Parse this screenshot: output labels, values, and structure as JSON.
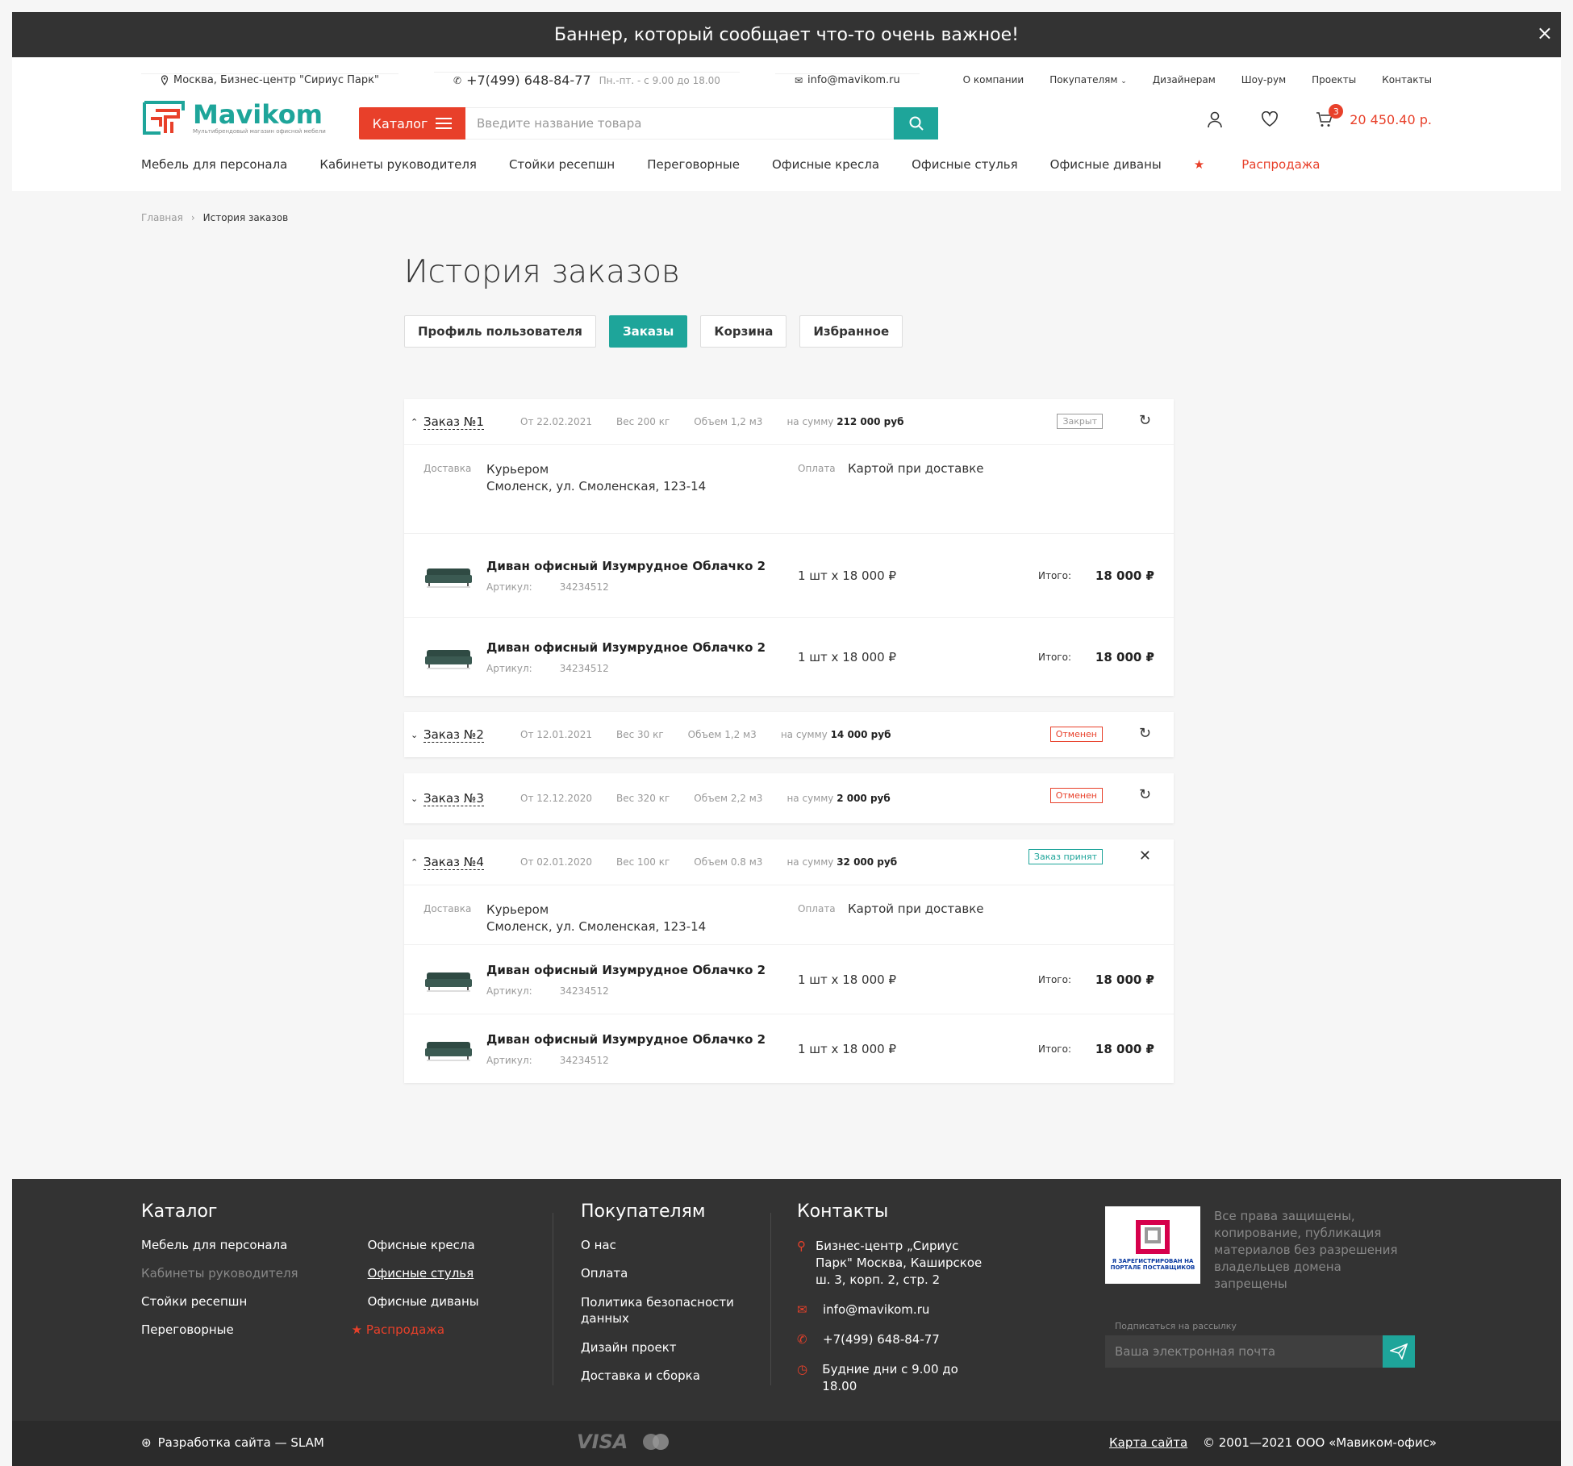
{
  "banner": {
    "text": "Баннер, который сообщает что-то очень важное!",
    "close": "×"
  },
  "topbar": {
    "address": "Москва, Бизнес-центр \"Сириус Парк\"",
    "phone": "+7(499) 648-84-77",
    "hours": "Пн.-пт. - с 9.00 до 18.00",
    "email": "info@mavikom.ru",
    "nav": [
      "О компании",
      "Покупателям",
      "Дизайнерам",
      "Шоу-рум",
      "Проекты",
      "Контакты"
    ]
  },
  "logo": {
    "name": "Mavikom",
    "sub": "Мультибрендовый магазин офисной мебели"
  },
  "search": {
    "catalog": "Каталог",
    "placeholder": "Введите название товара"
  },
  "cart": {
    "count": "3",
    "total": "20 450.40 р."
  },
  "mainnav": [
    "Мебель для персонала",
    "Кабинеты руководителя",
    "Стойки ресепшн",
    "Переговорные",
    "Офисные кресла",
    "Офисные стулья",
    "Офисные диваны"
  ],
  "sale": "Распродажа",
  "breadcrumbs": {
    "home": "Главная",
    "current": "История заказов"
  },
  "page_title": "История заказов",
  "tabs": [
    "Профиль пользователя",
    "Заказы",
    "Корзина",
    "Избранное"
  ],
  "labels": {
    "delivery": "Доставка",
    "payment": "Оплата",
    "article": "Артикул:",
    "total": "Итого:"
  },
  "orders": [
    {
      "title": "Заказ №1",
      "date": "От 22.02.2021",
      "weight": "Вес 200 кг",
      "volume": "Объем 1,2 м3",
      "sum_label": "на сумму",
      "sum": "212 000 руб",
      "status": "Закрыт",
      "delivery": "Курьером",
      "address": "Смоленск, ул. Смоленская, 123-14",
      "payment": "Картой при доставке",
      "items": [
        {
          "name": "Диван офисный Изумрудное Облачко 2",
          "article": "34234512",
          "qty": "1 шт х 18 000 ₽",
          "price": "18 000 ₽"
        },
        {
          "name": "Диван офисный Изумрудное Облачко 2",
          "article": "34234512",
          "qty": "1 шт х 18 000 ₽",
          "price": "18 000 ₽"
        }
      ]
    },
    {
      "title": "Заказ №2",
      "date": "От 12.01.2021",
      "weight": "Вес 30 кг",
      "volume": "Объем 1,2 м3",
      "sum_label": "на сумму",
      "sum": "14 000 руб",
      "status": "Отменен"
    },
    {
      "title": "Заказ №3",
      "date": "От 12.12.2020",
      "weight": "Вес 320 кг",
      "volume": "Объем 2,2 м3",
      "sum_label": "на сумму",
      "sum": "2 000 руб",
      "status": "Отменен"
    },
    {
      "title": "Заказ №4",
      "date": "От 02.01.2020",
      "weight": "Вес 100 кг",
      "volume": "Объем 0.8 м3",
      "sum_label": "на сумму",
      "sum": "32 000 руб",
      "status": "Заказ принят",
      "delivery": "Курьером",
      "address": "Смоленск, ул. Смоленская, 123-14",
      "payment": "Картой при доставке",
      "items": [
        {
          "name": "Диван офисный Изумрудное Облачко 2",
          "article": "34234512",
          "qty": "1 шт х 18 000 ₽",
          "price": "18 000 ₽"
        },
        {
          "name": "Диван офисный Изумрудное Облачко 2",
          "article": "34234512",
          "qty": "1 шт х 18 000 ₽",
          "price": "18 000 ₽"
        }
      ]
    }
  ],
  "footer": {
    "catalog_title": "Каталог",
    "catalog_col1": [
      "Мебель для персонала",
      "Кабинеты руководителя",
      "Стойки ресепшн",
      "Переговорные"
    ],
    "catalog_col2": [
      "Офисные кресла",
      "Офисные стулья",
      "Офисные диваны"
    ],
    "buyers_title": "Покупателям",
    "buyers": [
      "О нас",
      "Оплата",
      "Политика безопасности данных",
      "Дизайн проект",
      "Доставка и сборка"
    ],
    "contacts_title": "Контакты",
    "contact_address": "Бизнес-центр „Сириус Парк\" Москва, Каширское ш. 3, корп. 2, стр. 2",
    "contact_email": "info@mavikom.ru",
    "contact_phone": "+7(499) 648-84-77",
    "contact_hours": "Будние дни с 9.00 до 18.00",
    "seal_text": "Я ЗАРЕГИСТРИРОВАН НА ПОРТАЛЕ ПОСТАВЩИКОВ",
    "rights": "Все права защищены, копирование, публикация материалов без разрешения владельцев домена запрещены",
    "subscribe": "Подписаться на рассылку",
    "email_placeholder": "Ваша электронная почта"
  },
  "bottom": {
    "dev": "Разработка сайта — SLAM",
    "visa": "VISA",
    "sitemap": "Карта сайта",
    "copyright": "© 2001—2021 ООО «Мавиком-офис»"
  },
  "colors": {
    "accent": "#1ea59a",
    "brand_red": "#e8402a",
    "dark": "#333333"
  }
}
